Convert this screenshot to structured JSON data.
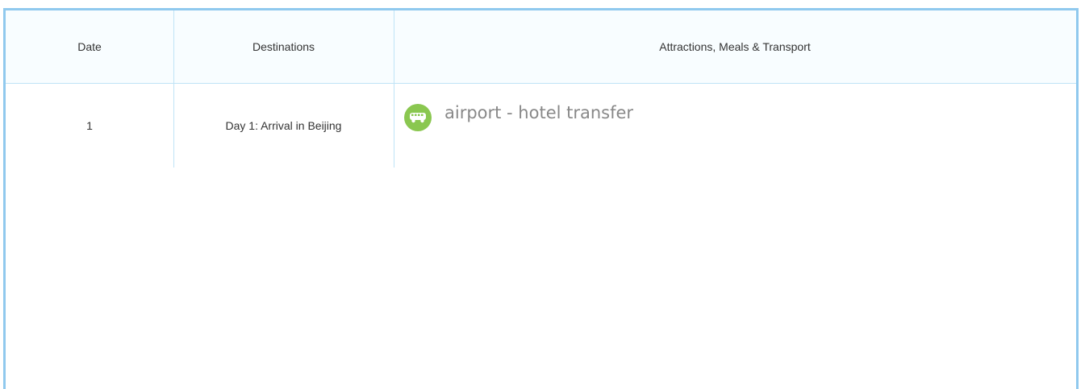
{
  "table": {
    "headers": {
      "date": "Date",
      "destinations": "Destinations",
      "attractions": "Attractions, Meals & Transport"
    },
    "rows": [
      {
        "date": "1",
        "destination": "Day 1: Arrival in Beijing",
        "items": [
          {
            "icon": "bus-icon",
            "icon_color": "#8ac750",
            "text": "airport - hotel transfer"
          }
        ]
      }
    ]
  },
  "colors": {
    "border": "#90c9ee",
    "grid": "#bfe3f6",
    "header_bg": "#f8fdff",
    "text": "#333333",
    "muted_text": "#888888"
  }
}
